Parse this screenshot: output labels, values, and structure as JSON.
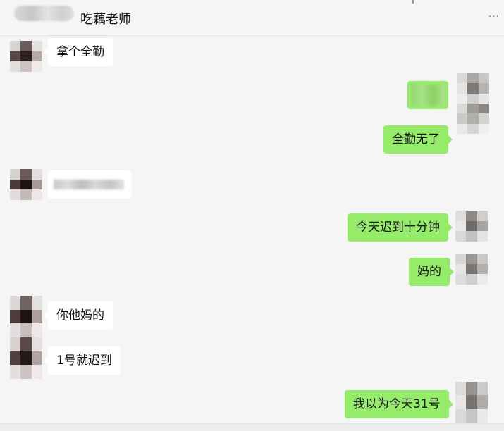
{
  "header": {
    "title": "吃藕老师",
    "more_icon": "more-dots-icon"
  },
  "messages": [
    {
      "side": "left",
      "text": "拿个全勤"
    },
    {
      "side": "right",
      "text": "",
      "obscured": true
    },
    {
      "side": "right",
      "text": "全勤无了"
    },
    {
      "side": "left",
      "text": "",
      "obscured": true
    },
    {
      "side": "right",
      "text": "今天迟到十分钟"
    },
    {
      "side": "right",
      "text": "妈的"
    },
    {
      "side": "left",
      "text": "你他妈的"
    },
    {
      "side": "left",
      "text": "1号就迟到"
    },
    {
      "side": "right",
      "text": "我以为今天31号"
    }
  ],
  "colors": {
    "background": "#f5f5f5",
    "bubble_self": "#95ec69",
    "bubble_other": "#ffffff"
  }
}
